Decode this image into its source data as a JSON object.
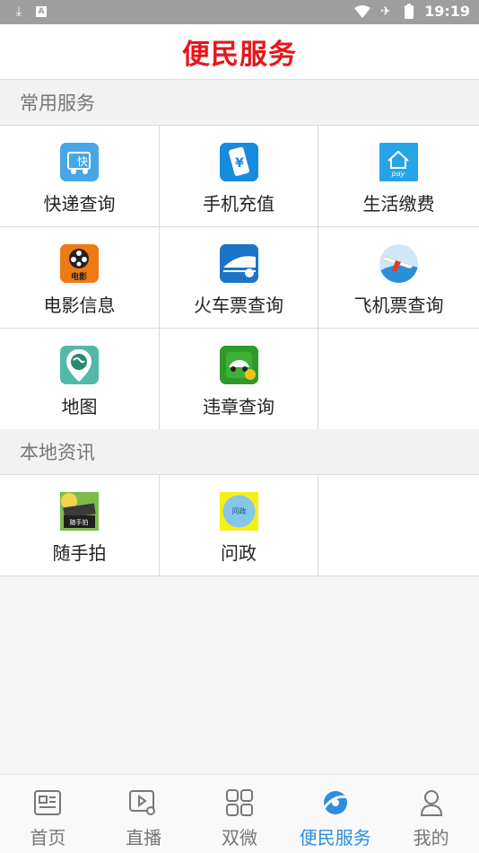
{
  "status_bar": {
    "time": "19:19",
    "icons": [
      "download-icon",
      "a-notification-icon",
      "wifi-icon",
      "airplane-icon",
      "battery-icon"
    ]
  },
  "header": {
    "title": "便民服务"
  },
  "sections": [
    {
      "title": "常用服务",
      "items": [
        {
          "label": "快递查询",
          "icon": "express-icon"
        },
        {
          "label": "手机充值",
          "icon": "mobile-recharge-icon"
        },
        {
          "label": "生活缴费",
          "icon": "life-pay-icon"
        },
        {
          "label": "电影信息",
          "icon": "movie-icon"
        },
        {
          "label": "火车票查询",
          "icon": "train-icon"
        },
        {
          "label": "飞机票查询",
          "icon": "plane-icon"
        },
        {
          "label": "地图",
          "icon": "map-icon"
        },
        {
          "label": "违章查询",
          "icon": "violation-icon"
        }
      ]
    },
    {
      "title": "本地资讯",
      "items": [
        {
          "label": "随手拍",
          "icon": "snapshot-icon"
        },
        {
          "label": "问政",
          "icon": "wenzheng-icon"
        }
      ]
    }
  ],
  "tabs": [
    {
      "label": "首页",
      "icon": "news-icon",
      "active": false
    },
    {
      "label": "直播",
      "icon": "live-icon",
      "active": false
    },
    {
      "label": "双微",
      "icon": "grid-icon",
      "active": false
    },
    {
      "label": "便民服务",
      "icon": "service-icon",
      "active": true
    },
    {
      "label": "我的",
      "icon": "user-icon",
      "active": false
    }
  ],
  "colors": {
    "title": "#e8151b",
    "active_tab": "#2d8de0",
    "status_bar": "#9e9e9e"
  },
  "icon_text": {
    "express": "快",
    "movie": "电影",
    "pay": "pay"
  }
}
